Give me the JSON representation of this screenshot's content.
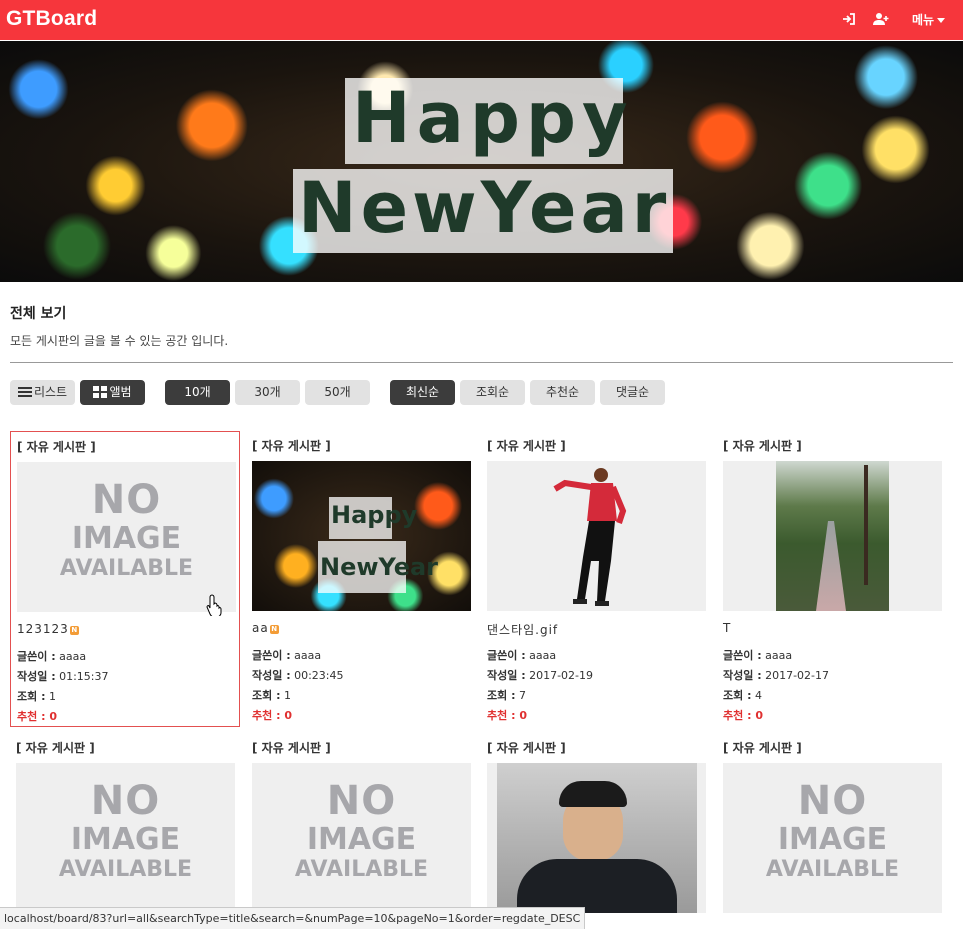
{
  "navbar": {
    "brand": "GTBoard",
    "login_icon": "sign-in-icon",
    "signup_icon": "user-plus-icon",
    "menu_label": "메뉴",
    "bg_color": "#f6363c"
  },
  "banner": {
    "line1": "Happy",
    "line2": "NewYear"
  },
  "page": {
    "title": "전체 보기",
    "description": "모든 게시판의 글을 볼 수 있는 공간 입니다."
  },
  "toolbar": {
    "view_list": "리스트",
    "view_album": "앨범",
    "count_10": "10개",
    "count_30": "30개",
    "count_50": "50개",
    "order_latest": "최신순",
    "order_views": "조회순",
    "order_recommend": "추천순",
    "order_comments": "댓글순"
  },
  "labels": {
    "author": "글쓴이 :",
    "date": "작성일 :",
    "views": "조회 :",
    "recommend": "추천 :",
    "new_badge": "N"
  },
  "no_image": {
    "l1": "NO",
    "l2": "IMAGE",
    "l3": "AVAILABLE"
  },
  "posts": [
    {
      "board": "[ 자유 게시판 ]",
      "title": "123123",
      "is_new": true,
      "author": "aaaa",
      "date": "01:15:37",
      "views": "1",
      "recommend": "0",
      "thumb": "no-image"
    },
    {
      "board": "[ 자유 게시판 ]",
      "title": "aa",
      "is_new": true,
      "author": "aaaa",
      "date": "00:23:45",
      "views": "1",
      "recommend": "0",
      "thumb": "happy-new-year"
    },
    {
      "board": "[ 자유 게시판 ]",
      "title": "댄스타임.gif",
      "is_new": false,
      "author": "aaaa",
      "date": "2017-02-19",
      "views": "7",
      "recommend": "0",
      "thumb": "dancer"
    },
    {
      "board": "[ 자유 게시판 ]",
      "title": "T",
      "is_new": false,
      "author": "aaaa",
      "date": "2017-02-17",
      "views": "4",
      "recommend": "0",
      "thumb": "forest-path"
    },
    {
      "board": "[ 자유 게시판 ]",
      "thumb": "no-image"
    },
    {
      "board": "[ 자유 게시판 ]",
      "thumb": "no-image"
    },
    {
      "board": "[ 자유 게시판 ]",
      "thumb": "person-photo"
    },
    {
      "board": "[ 자유 게시판 ]",
      "thumb": "no-image"
    }
  ],
  "statusbar": {
    "url": "localhost/board/83?url=all&searchType=title&search=&numPage=10&pageNo=1&order=regdate_DESC"
  }
}
